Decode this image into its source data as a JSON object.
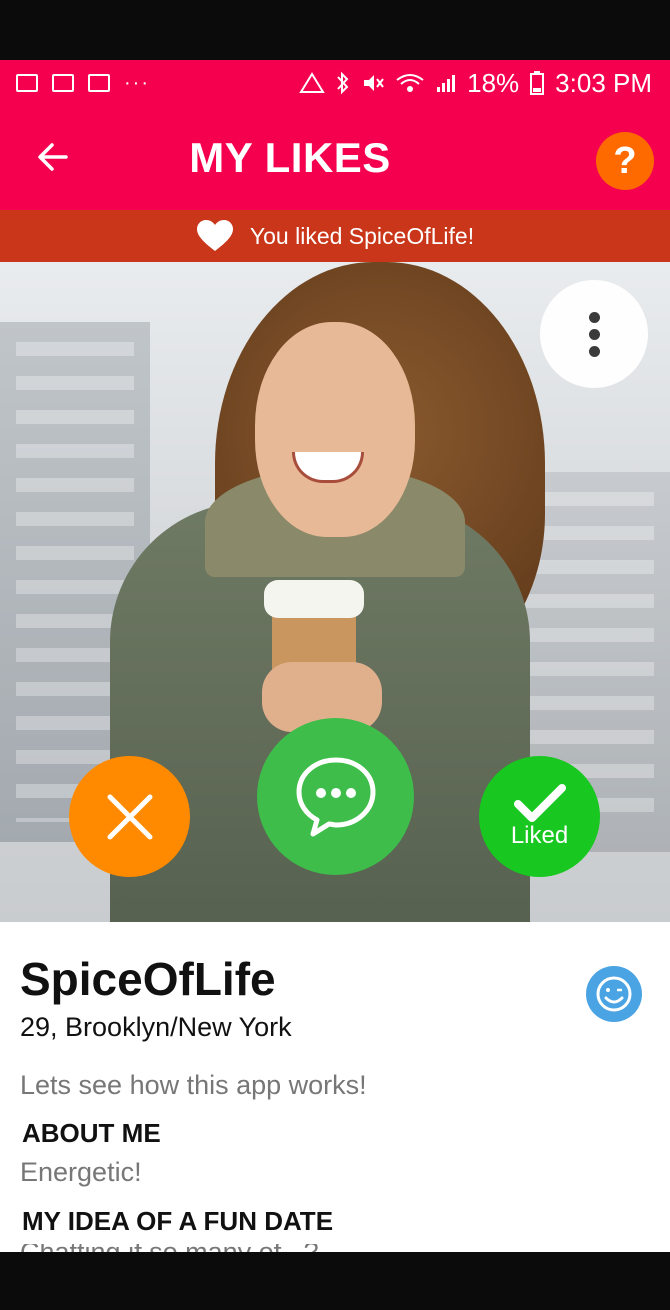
{
  "status_bar": {
    "battery": "18%",
    "time": "3:03 PM",
    "more_notifications": "···"
  },
  "app_bar": {
    "title": "MY LIKES",
    "help_label": "?"
  },
  "banner": {
    "text": "You liked SpiceOfLife!"
  },
  "actions": {
    "liked_label": "Liked"
  },
  "profile": {
    "name": "SpiceOfLife",
    "age_location": "29, Brooklyn/New York",
    "headline": "Lets see how this app works!",
    "about_heading": "ABOUT ME",
    "about_text": "Energetic!",
    "fun_date_heading": "MY IDEA OF A FUN DATE",
    "fun_date_text": "Chatting if so many of...?"
  },
  "colors": {
    "app_bar": "#f5004f",
    "banner": "#c9361a",
    "dislike": "#ff8a00",
    "chat": "#3ebd4a",
    "liked": "#18c71f",
    "help": "#ff6a00",
    "smiley": "#4aa3e3"
  }
}
